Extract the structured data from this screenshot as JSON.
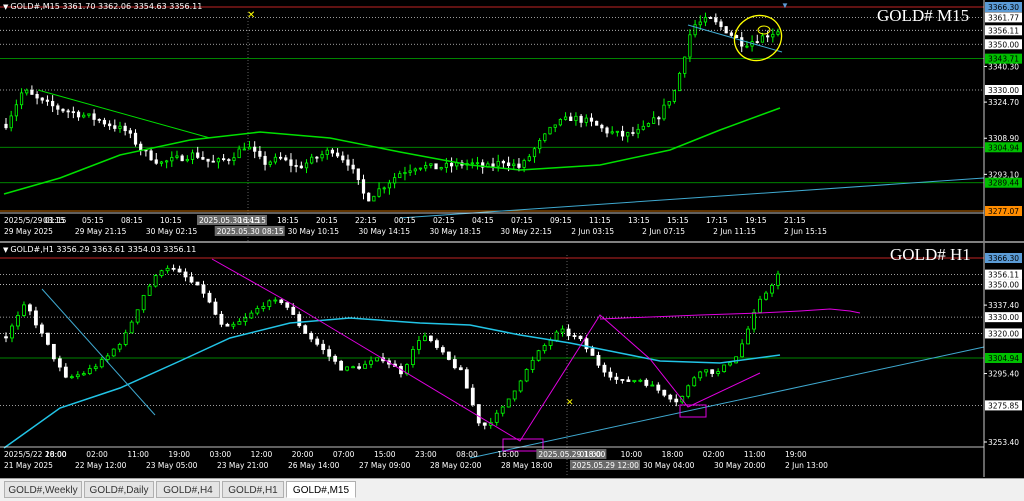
{
  "charts": [
    {
      "id": "top",
      "header": "GOLD#,M15  3361.70 3362.06 3354.63 3356.11",
      "title": "GOLD# M15",
      "price_labels": [
        {
          "text": "3366.30",
          "y": 3366.3,
          "bg": "#5b9bd5",
          "fg": "#000"
        },
        {
          "text": "3361.77",
          "y": 3361.77,
          "bg": "#ffffff",
          "fg": "#000"
        },
        {
          "text": "3356.11",
          "y": 3356.11,
          "bg": "#ffffff",
          "fg": "#000"
        },
        {
          "text": "3350.00",
          "y": 3350.0,
          "bg": "#ffffff",
          "fg": "#000"
        },
        {
          "text": "3340.30",
          "y": 3340.3,
          "bg": "",
          "fg": "#fff"
        },
        {
          "text": "3343.71",
          "y": 3343.71,
          "bg": "#00c000",
          "fg": "#000"
        },
        {
          "text": "3330.00",
          "y": 3330.0,
          "bg": "#ffffff",
          "fg": "#000"
        },
        {
          "text": "3324.70",
          "y": 3324.7,
          "bg": "",
          "fg": "#fff"
        },
        {
          "text": "3308.90",
          "y": 3308.9,
          "bg": "",
          "fg": "#fff"
        },
        {
          "text": "3304.94",
          "y": 3304.94,
          "bg": "#00c000",
          "fg": "#000"
        },
        {
          "text": "3293.10",
          "y": 3293.1,
          "bg": "",
          "fg": "#fff"
        },
        {
          "text": "3289.44",
          "y": 3289.44,
          "bg": "#00c000",
          "fg": "#000"
        },
        {
          "text": "3277.07",
          "y": 3277.07,
          "bg": "#ff8c00",
          "fg": "#000"
        }
      ],
      "time_labels": [
        "2025/5/29 01:15",
        "03:15",
        "05:15",
        "08:15",
        "10:15",
        "2025.05.30 14:15",
        "16:15",
        "18:15",
        "20:15",
        "22:15",
        "00:15",
        "02:15",
        "04:15",
        "07:15",
        "09:15",
        "11:15",
        "13:15",
        "15:15",
        "17:15",
        "19:15",
        "21:15"
      ],
      "time_labels2": [
        "29 May 2025",
        "29 May 21:15",
        "30 May 02:15",
        "2025.05.30 08:15",
        "30 May 10:15",
        "30 May 14:15",
        "30 May 18:15",
        "30 May 22:15",
        "2 Jun 03:15",
        "2 Jun 07:15",
        "2 Jun 11:15",
        "2 Jun 15:15"
      ]
    },
    {
      "id": "bot",
      "header": "GOLD#,H1  3356.29 3363.61 3354.03 3356.11",
      "title": "GOLD# H1",
      "price_labels": [
        {
          "text": "3366.30",
          "y": 3366.3,
          "bg": "#5b9bd5",
          "fg": "#000"
        },
        {
          "text": "3356.11",
          "y": 3356.11,
          "bg": "#ffffff",
          "fg": "#000"
        },
        {
          "text": "3350.00",
          "y": 3350.0,
          "bg": "#ffffff",
          "fg": "#000"
        },
        {
          "text": "3337.40",
          "y": 3337.4,
          "bg": "",
          "fg": "#fff"
        },
        {
          "text": "3330.00",
          "y": 3330.0,
          "bg": "#ffffff",
          "fg": "#000"
        },
        {
          "text": "3320.00",
          "y": 3320.0,
          "bg": "#ffffff",
          "fg": "#000"
        },
        {
          "text": "3304.94",
          "y": 3304.94,
          "bg": "#00c000",
          "fg": "#000"
        },
        {
          "text": "3295.40",
          "y": 3295.4,
          "bg": "",
          "fg": "#fff"
        },
        {
          "text": "3275.85",
          "y": 3275.85,
          "bg": "#ffffff",
          "fg": "#000"
        },
        {
          "text": "3253.40",
          "y": 3253.4,
          "bg": "",
          "fg": "#fff"
        }
      ],
      "time_labels": [
        "2025/5/22 20:00",
        "18:00",
        "02:00",
        "11:00",
        "19:00",
        "03:00",
        "12:00",
        "20:00",
        "07:00",
        "15:00",
        "23:00",
        "08:00",
        "16:00",
        "2025.05.29 18:00",
        "01:00",
        "10:00",
        "18:00",
        "02:00",
        "11:00",
        "19:00"
      ],
      "time_labels2": [
        "21 May 2025",
        "22 May 12:00",
        "23 May 05:00",
        "23 May 21:00",
        "26 May 14:00",
        "27 May 09:00",
        "28 May 02:00",
        "28 May 18:00",
        "2025.05.29 12:00",
        "30 May 04:00",
        "30 May 20:00",
        "2 Jun 13:00"
      ]
    }
  ],
  "tabs": [
    {
      "label": "GOLD#,Weekly",
      "active": false
    },
    {
      "label": "GOLD#,Daily",
      "active": false
    },
    {
      "label": "GOLD#,H4",
      "active": false
    },
    {
      "label": "GOLD#,H1",
      "active": false
    },
    {
      "label": "GOLD#,M15",
      "active": true
    }
  ],
  "colors": {
    "bull": "#00ff00",
    "bear": "#ffffff",
    "ma_green": "#00e000",
    "ma_cyan": "#22c4e6",
    "hline_green": "#00b000",
    "trend_cyan": "#3fa9d0",
    "magenta": "#e000e0",
    "yellow": "#ffff00"
  }
}
